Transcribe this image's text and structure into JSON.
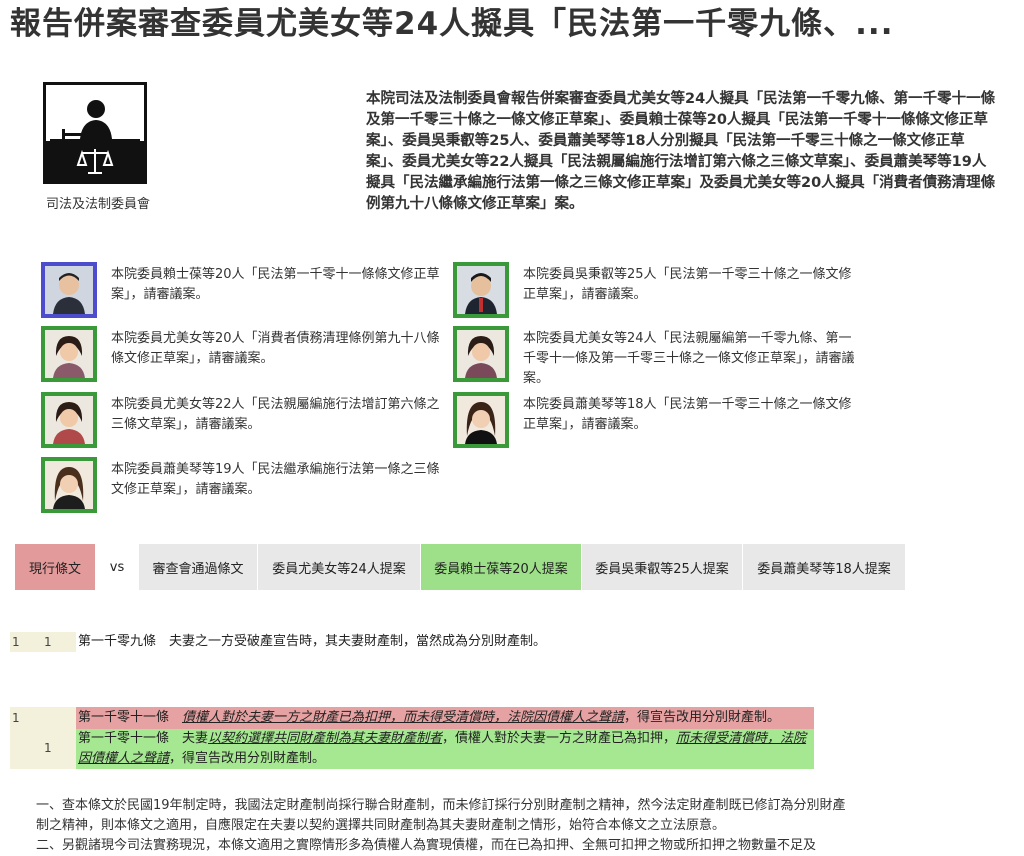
{
  "page": {
    "title": "報告併案審查委員尤美女等24人擬具「民法第一千零九條、..."
  },
  "committee": {
    "name": "司法及法制委員會",
    "icon": "judicial-committee-icon"
  },
  "summary": "本院司法及法制委員會報告併案審查委員尤美女等24人擬具「民法第一千零九條、第一千零十一條及第一千零三十條之一條文修正草案」、委員賴士葆等20人擬具「民法第一千零十一條條文修正草案」、委員吳秉叡等25人、委員蕭美琴等18人分別擬具「民法第一千零三十條之一條文修正草案」、委員尤美女等22人擬具「民法親屬編施行法增訂第六條之三條文草案」、委員蕭美琴等19人擬具「民法繼承編施行法第一條之三條文修正草案」及委員尤美女等20人擬具「消費者債務清理條例第九十八條條文修正草案」案。",
  "bills": [
    {
      "text": "本院委員賴士葆等20人「民法第一千零十一條條文修正草案」，請審議案。",
      "avatar_border": "#4c4ccc"
    },
    {
      "text": "本院委員吳秉叡等25人「民法第一千零三十條之一條文修正草案」，請審議案。",
      "avatar_border": "#3a9a3a"
    },
    {
      "text": "本院委員尤美女等20人「消費者債務清理條例第九十八條條文修正草案」，請審議案。",
      "avatar_border": "#3a9a3a"
    },
    {
      "text": "本院委員尤美女等24人「民法親屬編第一千零九條、第一千零十一條及第一千零三十條之一條文修正草案」，請審議案。",
      "avatar_border": "#3a9a3a"
    },
    {
      "text": "本院委員尤美女等22人「民法親屬編施行法增訂第六條之三條文草案」，請審議案。",
      "avatar_border": "#3a9a3a"
    },
    {
      "text": "本院委員蕭美琴等18人「民法第一千零三十條之一條文修正草案」，請審議案。",
      "avatar_border": "#3a9a3a"
    },
    {
      "text": "本院委員蕭美琴等19人「民法繼承編施行法第一條之三條文修正草案」，請審議案。",
      "avatar_border": "#3a9a3a"
    }
  ],
  "tabs": {
    "current": "現行條文",
    "vs": "vs",
    "passed": "審查會通過條文",
    "yu24": "委員尤美女等24人提案",
    "lai20": "委員賴士葆等20人提案",
    "wu25": "委員吳秉叡等25人提案",
    "hsiao18": "委員蕭美琴等18人提案"
  },
  "diff": {
    "row1": {
      "num_a": "1",
      "num_b": "1",
      "text": "第一千零九條　夫妻之一方受破產宣告時，其夫妻財產制，當然成為分別財產制。"
    },
    "row2": {
      "num_a": "1",
      "num_b": "1",
      "red_prefix": "第一千零十一條　",
      "red_emph": "債權人對於夫妻一方之財產已為扣押，而未得受清償時，法院因債權人之聲請",
      "red_suffix": "，得宣告改用分別財產制。",
      "green_prefix": "第一千零十一條　夫妻",
      "green_emph1": "以契約選擇共同財產制為其夫妻財產制者",
      "green_mid": "，債權人對於夫妻一方之財產已為扣押，",
      "green_emph2": "而未得受清償時，法院因債權人之聲請",
      "green_suffix": "，得宣告改用分別財產制。"
    }
  },
  "explanation": [
    "一、查本條文於民國19年制定時，我國法定財產制尚採行聯合財產制，而未修訂採行分別財產制之精神，然今法定財產制既已修訂為分別財產制之精神，則本條文之適用，自應限定在夫妻以契約選擇共同財產制為其夫妻財產制之情形，始符合本條文之立法原意。",
    "二、另觀諸現今司法實務現況，本條文適用之實際情形多為債權人為實現債權，而在已為扣押、全無可扣押之物或所扣押之物數量不足及"
  ]
}
